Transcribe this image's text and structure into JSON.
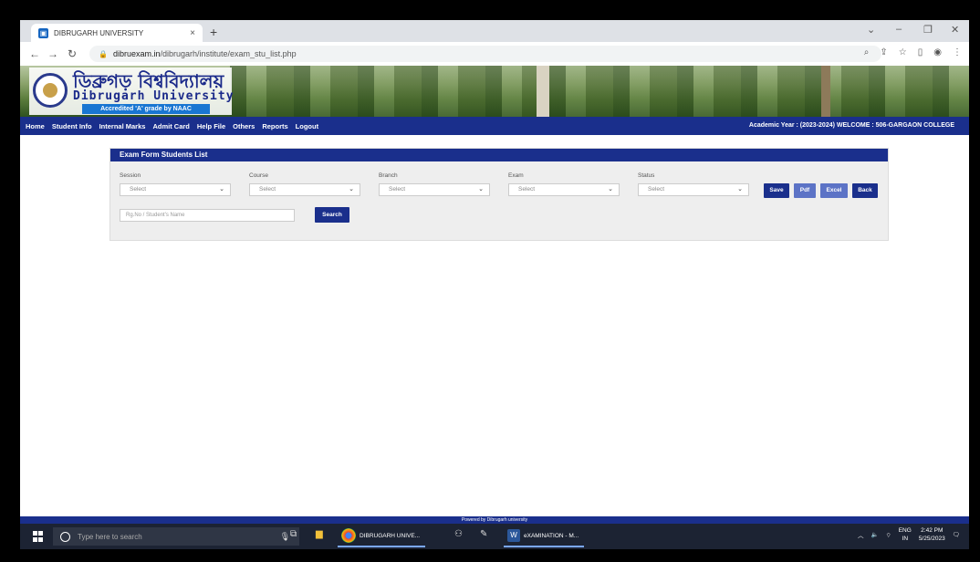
{
  "browser": {
    "tab_title": "DIBRUGARH UNIVERSITY",
    "tab_close": "×",
    "new_tab": "+",
    "url_domain": "dibruexam.in",
    "url_path": "/dibrugarh/institute/exam_stu_list.php",
    "window_controls": [
      "⌄",
      "–",
      "❐",
      "✕"
    ]
  },
  "banner": {
    "bengali_name": "ডিব্ৰুগড় বিশ্ববিদ্যালয়",
    "english_name": "Dibrugarh University",
    "accreditation": "Accredited 'A' grade by NAAC"
  },
  "nav": {
    "items": [
      "Home",
      "Student Info",
      "Internal Marks",
      "Admit Card",
      "Help File",
      "Others",
      "Reports",
      "Logout"
    ],
    "academic_info": "Academic Year : (2023-2024) WELCOME : 506-GARGAON COLLEGE"
  },
  "panel": {
    "title": "Exam Form Students List",
    "filters": [
      {
        "label": "Session",
        "value": "Select"
      },
      {
        "label": "Course",
        "value": "Select"
      },
      {
        "label": "Branch",
        "value": "Select"
      },
      {
        "label": "Exam",
        "value": "Select"
      },
      {
        "label": "Status",
        "value": "Select"
      }
    ],
    "buttons": {
      "save": "Save",
      "pdf": "Pdf",
      "excel": "Excel",
      "back": "Back"
    },
    "search_placeholder": "Rg.No / Student's Name",
    "search_button": "Search"
  },
  "footer": {
    "text": "Powered by Dibrugarh university"
  },
  "taskbar": {
    "search_placeholder": "Type here to search",
    "app1_label": "DIBRUGARH UNIVE...",
    "app2_label": "eXAMINATION - M...",
    "lang_line1": "ENG",
    "lang_line2": "IN",
    "time": "2:42 PM",
    "date": "5/25/2023"
  },
  "colors": {
    "nav_blue": "#1a2f8c",
    "button_light": "#5c73c6"
  }
}
